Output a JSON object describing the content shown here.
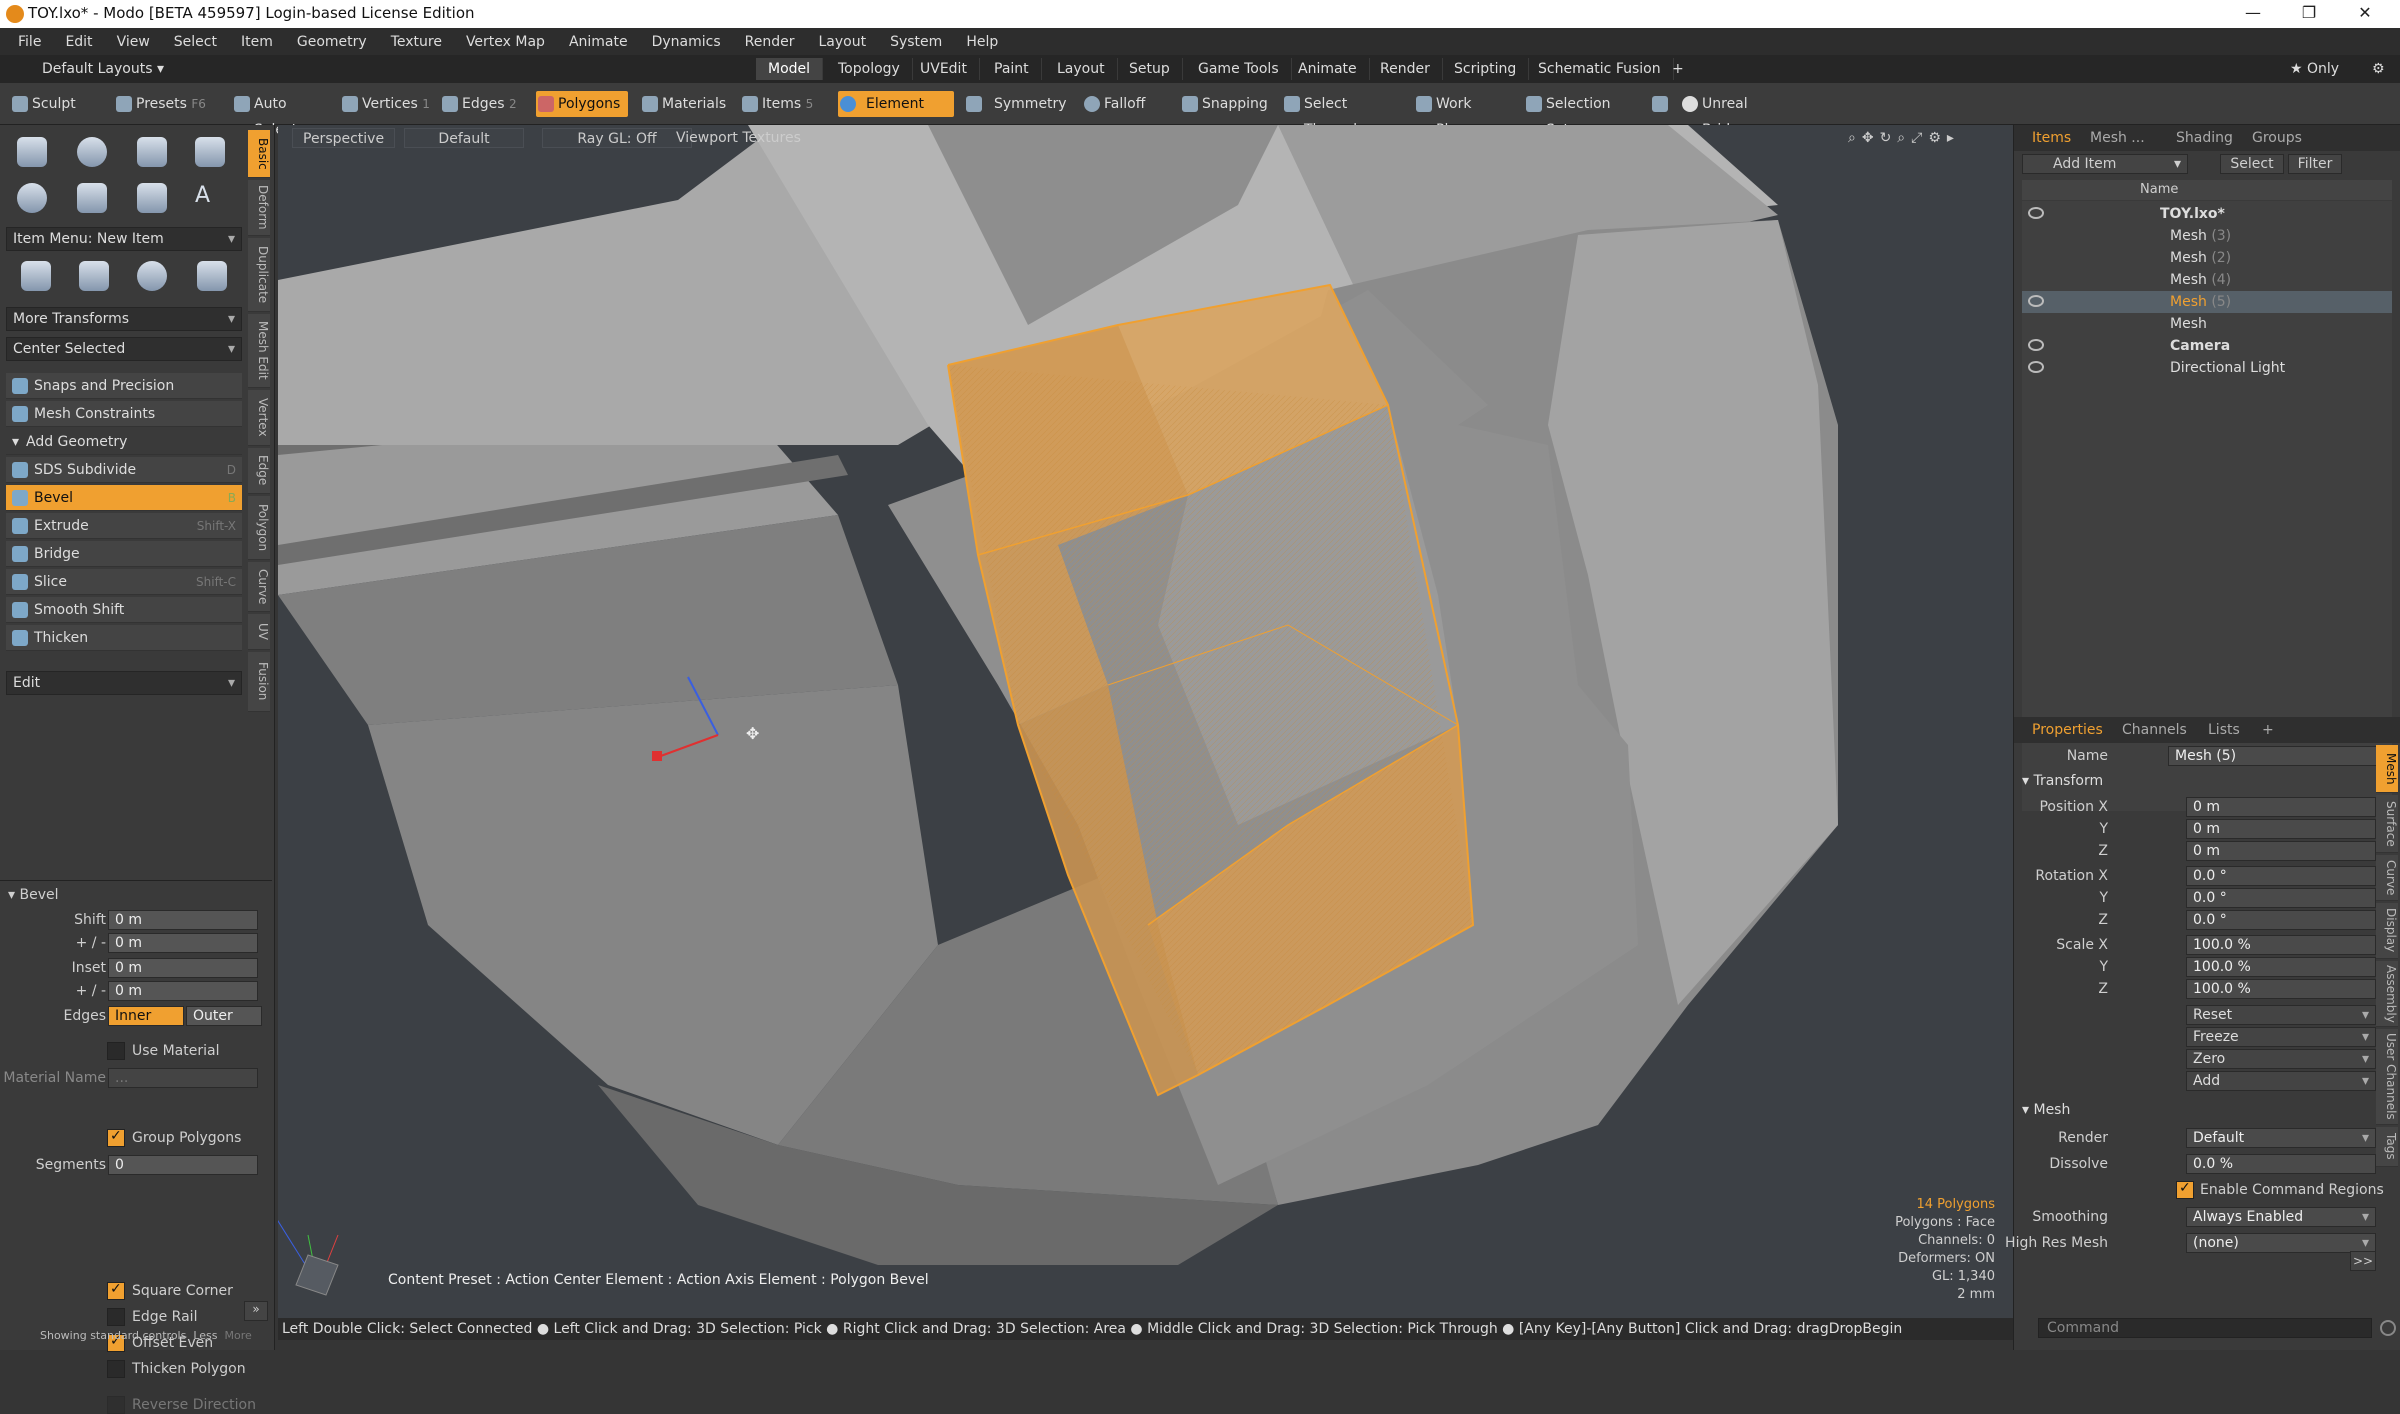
{
  "window": {
    "title": "TOY.lxo* - Modo [BETA 459597] Login-based License Edition",
    "minimize": "—",
    "maximize": "❐",
    "close": "✕"
  },
  "menu": [
    "File",
    "Edit",
    "View",
    "Select",
    "Item",
    "Geometry",
    "Texture",
    "Vertex Map",
    "Animate",
    "Dynamics",
    "Render",
    "Layout",
    "System",
    "Help"
  ],
  "layout": {
    "preset": "Default Layouts ▾",
    "tabs": [
      "Model",
      "Topology",
      "UVEdit",
      "Paint",
      "Layout",
      "Setup",
      "Game Tools",
      "Animate",
      "Render",
      "Scripting",
      "Schematic Fusion"
    ],
    "add": "+",
    "only": "★ Only"
  },
  "toolbar": {
    "sculpt": "Sculpt",
    "presets": "Presets",
    "presets_key": "F6",
    "auto_select": "Auto Select",
    "vertices": "Vertices",
    "vertices_n": "1",
    "edges": "Edges",
    "edges_n": "2",
    "polygons": "Polygons",
    "materials": "Materials",
    "items": "Items",
    "items_n": "5",
    "element": "Element",
    "symmetry": "Symmetry",
    "falloff": "Falloff",
    "snapping": "Snapping",
    "select_through": "Select Through",
    "work_plane": "Work Plane",
    "selection_sets": "Selection Sets",
    "unreal_bridge": "Unreal Bridge"
  },
  "left": {
    "item_menu": "Item Menu: New Item",
    "more_transforms": "More Transforms",
    "center_selected": "Center Selected",
    "snaps": "Snaps and Precision",
    "mesh_constraints": "Mesh Constraints",
    "add_geometry": "Add Geometry",
    "tools": [
      {
        "label": "SDS Subdivide",
        "key": "D"
      },
      {
        "label": "Bevel",
        "key": "B"
      },
      {
        "label": "Extrude",
        "key": "Shift-X"
      },
      {
        "label": "Bridge",
        "key": ""
      },
      {
        "label": "Slice",
        "key": "Shift-C"
      },
      {
        "label": "Smooth Shift",
        "key": ""
      },
      {
        "label": "Thicken",
        "key": ""
      }
    ],
    "edit": "Edit",
    "vtabs": [
      "Basic",
      "Deform",
      "Duplicate",
      "Mesh Edit",
      "Vertex",
      "Edge",
      "Polygon",
      "Curve",
      "UV",
      "Fusion"
    ]
  },
  "bevel": {
    "title": "Bevel",
    "shift_label": "Shift",
    "shift": "0 m",
    "pm_label": "+ / -",
    "pm1": "0 m",
    "inset_label": "Inset",
    "inset": "0 m",
    "pm2": "0 m",
    "edges_label": "Edges",
    "inner": "Inner",
    "outer": "Outer",
    "use_material": "Use Material",
    "material_name_label": "Material Name",
    "material_name": "...",
    "group_polygons": "Group Polygons",
    "segments_label": "Segments",
    "segments": "0",
    "square_corner": "Square Corner",
    "edge_rail": "Edge Rail",
    "offset_even": "Offset Even",
    "thicken_polygon": "Thicken Polygon",
    "reverse_direction": "Reverse Direction",
    "showing": "Showing standard controls",
    "less": "Less",
    "more": "More"
  },
  "viewport": {
    "perspective": "Perspective",
    "default": "Default",
    "raygl": "Ray GL: Off",
    "textures": "Viewport Textures",
    "preset_line": "Content Preset : Action Center Element : Action Axis Element : Polygon Bevel",
    "info": {
      "polys": "14 Polygons",
      "polys_face": "Polygons : Face",
      "channels": "Channels: 0",
      "deformers": "Deformers: ON",
      "gl": "GL: 1,340",
      "mm": "2 mm"
    }
  },
  "status": "Left Double Click: Select Connected ● Left Click and Drag: 3D Selection: Pick ● Right Click and Drag: 3D Selection: Area ● Middle Click and Drag: 3D Selection: Pick Through ● [Any Key]-[Any Button] Click and Drag: dragDropBegin",
  "items_panel": {
    "tabs": [
      "Items",
      "Mesh ...",
      "Shading",
      "Groups"
    ],
    "add_item": "Add Item",
    "select": "Select",
    "filter": "Filter",
    "name_col": "Name",
    "tree": [
      {
        "name": "TOY.lxo*",
        "idx": ""
      },
      {
        "name": "Mesh",
        "idx": "(3)"
      },
      {
        "name": "Mesh",
        "idx": "(2)"
      },
      {
        "name": "Mesh",
        "idx": "(4)"
      },
      {
        "name": "Mesh",
        "idx": "(5)"
      },
      {
        "name": "Mesh",
        "idx": ""
      },
      {
        "name": "Camera",
        "idx": ""
      },
      {
        "name": "Directional Light",
        "idx": ""
      }
    ]
  },
  "properties": {
    "tabs": [
      "Properties",
      "Channels",
      "Lists"
    ],
    "add": "+",
    "name_label": "Name",
    "name": "Mesh (5)",
    "transform": "Transform",
    "pos_x": "Position X",
    "pos_x_v": "0 m",
    "y": "Y",
    "pos_y_v": "0 m",
    "z": "Z",
    "pos_z_v": "0 m",
    "rot_x": "Rotation X",
    "rot_x_v": "0.0 °",
    "rot_y_v": "0.0 °",
    "rot_z_v": "0.0 °",
    "scale_x": "Scale X",
    "scale_x_v": "100.0 %",
    "scale_y_v": "100.0 %",
    "scale_z_v": "100.0 %",
    "reset": "Reset",
    "freeze": "Freeze",
    "zero": "Zero",
    "add_btn": "Add",
    "mesh": "Mesh",
    "render_label": "Render",
    "render": "Default",
    "dissolve_label": "Dissolve",
    "dissolve": "0.0 %",
    "enable_cmd": "Enable Command Regions",
    "smoothing_label": "Smoothing",
    "smoothing": "Always Enabled",
    "highres_label": "High Res Mesh",
    "highres": "(none)",
    "more": ">>",
    "side_tabs": [
      "Mesh",
      "Surface",
      "Curve",
      "Display",
      "Assembly",
      "User Channels",
      "Tags"
    ]
  },
  "command": "Command",
  "colors": {
    "accent": "#f0a030",
    "selection": "#e9a13c"
  }
}
